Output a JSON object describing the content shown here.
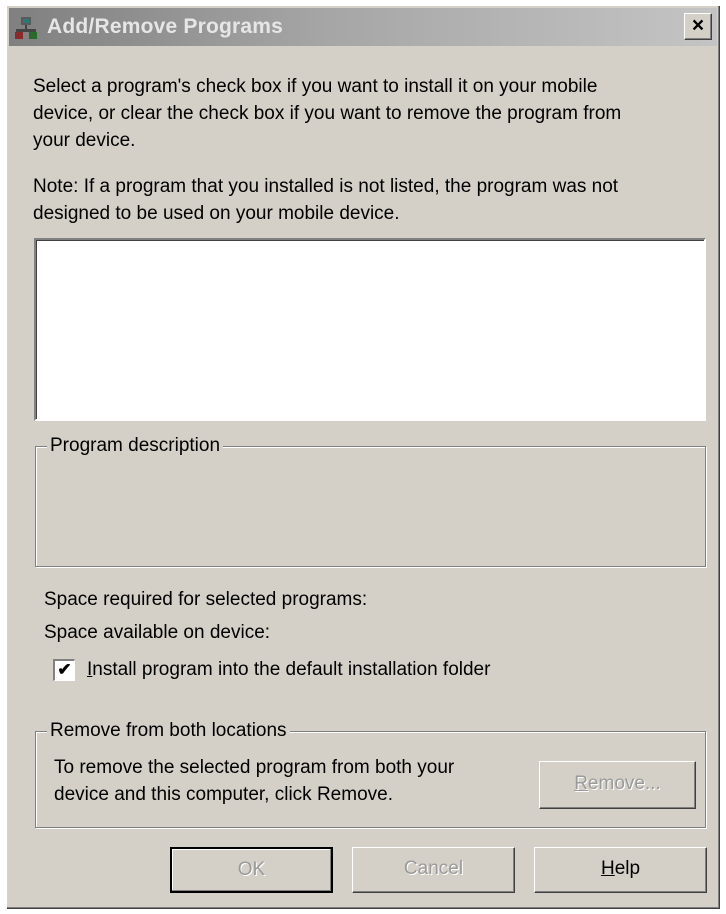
{
  "window": {
    "title": "Add/Remove Programs",
    "close_label": "×"
  },
  "instructions": {
    "line1": "Select a program's check box if you want to install it on your mobile",
    "line2": "device, or clear the check box if you want to remove the program from",
    "line3": "your device."
  },
  "note": {
    "line1": "Note:  If a program that you installed is not listed, the program was not",
    "line2": "designed to be used on your mobile device."
  },
  "program_list": {
    "items": []
  },
  "program_description": {
    "label": "Program description",
    "text": ""
  },
  "space": {
    "required_label": "Space required for selected programs:",
    "available_label": "Space available on device:"
  },
  "install_default": {
    "checked": true,
    "check_mark": "✔",
    "label": "Install program into the default installation folder",
    "mnemonic": "I",
    "label_rest": "nstall program into the default installation folder"
  },
  "remove_both": {
    "label": "Remove from both locations",
    "text_line1": "To remove the selected program from both your",
    "text_line2": "device and this computer, click Remove.",
    "button_mnemonic": "R",
    "button_rest": "emove...",
    "button_enabled": false
  },
  "buttons": {
    "ok": "OK",
    "cancel": "Cancel",
    "help_mnemonic": "H",
    "help_rest": "elp"
  },
  "colors": {
    "dialog_face": "#d4d0c8",
    "title_inactive_start": "#808080",
    "title_inactive_end": "#c4c4c4",
    "disabled_text": "#9a9a9a"
  }
}
